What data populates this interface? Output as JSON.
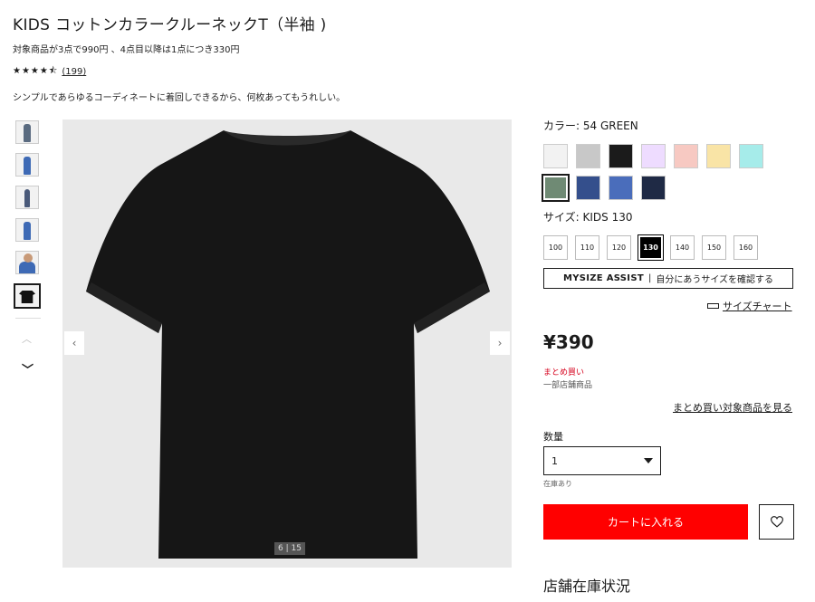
{
  "product": {
    "title": "KIDS コットンカラークルーネックT（半袖 )",
    "promo": "対象商品が3点で990円 、4点目以降は1点につき330円",
    "stars": "★★★★⯪",
    "review_count": "(199)",
    "description": "シンプルであらゆるコーディネートに着回しできるから、何枚あってもうれしい。"
  },
  "gallery": {
    "thumbnails": [
      {
        "icon": "model-fullbody",
        "color": "#5a6b80"
      },
      {
        "icon": "model-fullbody",
        "color": "#3e6ab5"
      },
      {
        "icon": "model-fullbody",
        "color": "#4a5a7a"
      },
      {
        "icon": "model-fullbody",
        "color": "#3e6ab5"
      },
      {
        "icon": "model-portrait",
        "color": "#3e6ab5"
      },
      {
        "icon": "tshirt-black",
        "color": "#111111"
      }
    ],
    "counter": "6 | 15",
    "prev_glyph": "‹",
    "next_glyph": "›",
    "up_glyph": "︿",
    "down_glyph": "﹀",
    "hero_color": "#161616"
  },
  "color": {
    "label": "カラー:  54 GREEN",
    "swatches": [
      {
        "hex": "#f2f2f2",
        "selected": false
      },
      {
        "hex": "#c8c8c8",
        "selected": false
      },
      {
        "hex": "#1b1b1b",
        "selected": false
      },
      {
        "hex": "#eedcff",
        "selected": false
      },
      {
        "hex": "#f7c9c2",
        "selected": false
      },
      {
        "hex": "#f9e4a6",
        "selected": false
      },
      {
        "hex": "#a6ecea",
        "selected": false
      },
      {
        "hex": "#6f8a74",
        "selected": true
      },
      {
        "hex": "#344f8c",
        "selected": false
      },
      {
        "hex": "#4a6dbb",
        "selected": false
      },
      {
        "hex": "#1f2a45",
        "selected": false
      }
    ]
  },
  "size": {
    "label": "サイズ:  KIDS 130",
    "options": [
      "100",
      "110",
      "120",
      "130",
      "140",
      "150",
      "160"
    ],
    "selected": "130"
  },
  "mysize": {
    "bold": "MYSIZE ASSIST",
    "sep": "|",
    "text": "自分にあうサイズを確認する"
  },
  "size_chart": "サイズチャート",
  "price": "¥390",
  "bulk_label": "まとめ買い",
  "partial_stores": "一部店舗商品",
  "bulk_link": "まとめ買い対象商品を見る",
  "quantity": {
    "label": "数量",
    "value": "1",
    "stock_note": "在庫あり"
  },
  "cart_button": "カートに入れる",
  "store_stock": "店舗在庫状況",
  "colors": {
    "accent_red": "#ff0000",
    "bulk_red": "#d6001c"
  }
}
